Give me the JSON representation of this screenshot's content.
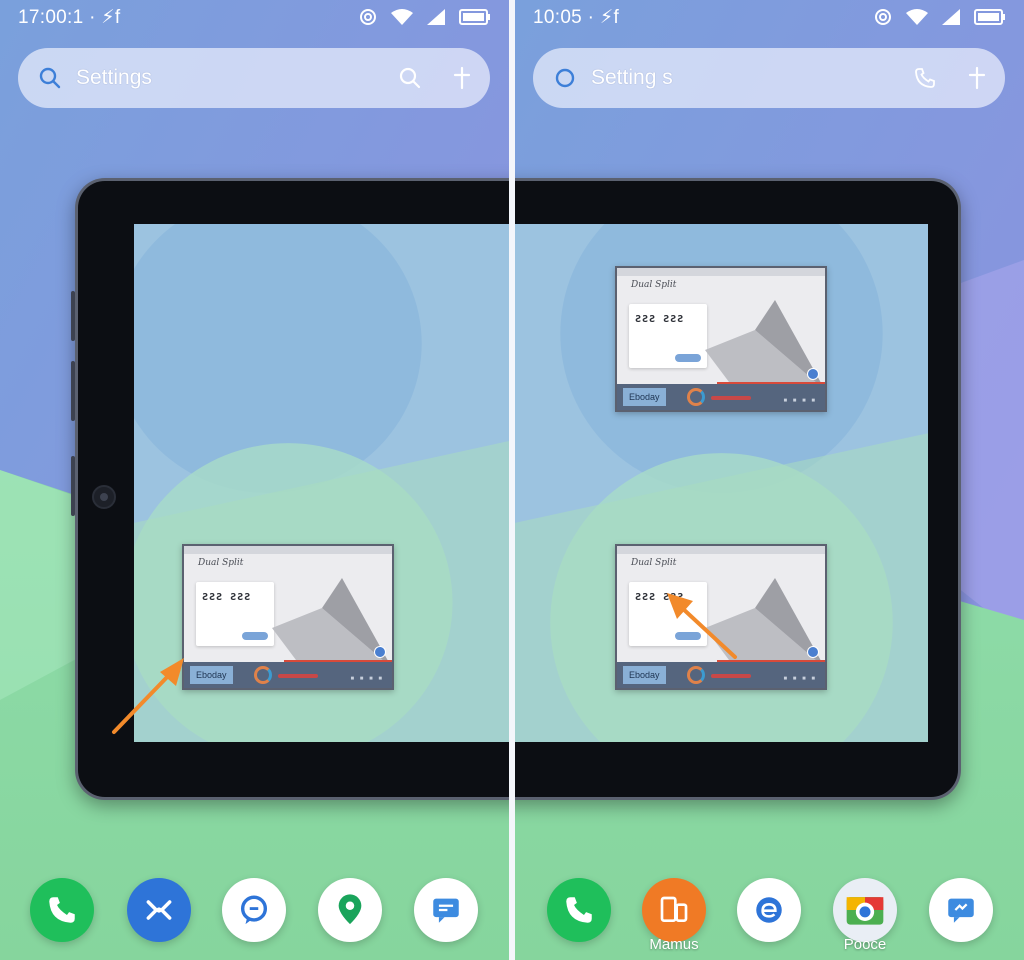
{
  "left_panel": {
    "status_time": "17:00:1 · ⚡f",
    "search_label": "Settings",
    "mini_window": {
      "title": "Dual Split",
      "code": "ƧƧƧ ƧƧƧ",
      "tag": "Eboday"
    },
    "dock": [
      {
        "icon": "phone-icon",
        "color": "#1fbf5b",
        "label": ""
      },
      {
        "icon": "split-screen-icon",
        "color": "#2e74d8",
        "label": ""
      },
      {
        "icon": "chat-bubble-icon",
        "color": "#ffffff",
        "label": ""
      },
      {
        "icon": "maps-pin-icon",
        "color": "#ffffff",
        "label": ""
      },
      {
        "icon": "message-icon",
        "color": "#ffffff",
        "label": ""
      }
    ]
  },
  "right_panel": {
    "status_time": "10:05 · ⚡f",
    "search_label": "Setting s",
    "mini_window_top": {
      "title": "Dual Split",
      "code": "ƧƧƧ ƧƧƧ",
      "tag": "Eboday"
    },
    "mini_window_bottom": {
      "title": "Dual Split",
      "code": "ƧƧƧ ƧƧƧ",
      "tag": "Eboday"
    },
    "dock": [
      {
        "icon": "phone-icon",
        "color": "#1fbf5b",
        "label": ""
      },
      {
        "icon": "devices-icon",
        "color": "#f07a25",
        "label": "Mamus"
      },
      {
        "icon": "browser-icon",
        "color": "#ffffff",
        "label": ""
      },
      {
        "icon": "camera-icon",
        "color": "#e9eef5",
        "label": "Pooce"
      },
      {
        "icon": "message-icon",
        "color": "#ffffff",
        "label": ""
      }
    ]
  },
  "colors": {
    "wallpaper_top": "#7d95d8",
    "wallpaper_mid": "#9aa6e6",
    "wallpaper_bottom": "#8fd8a6",
    "arrow": "#f28a2b",
    "bezel": "#0c0e13"
  }
}
